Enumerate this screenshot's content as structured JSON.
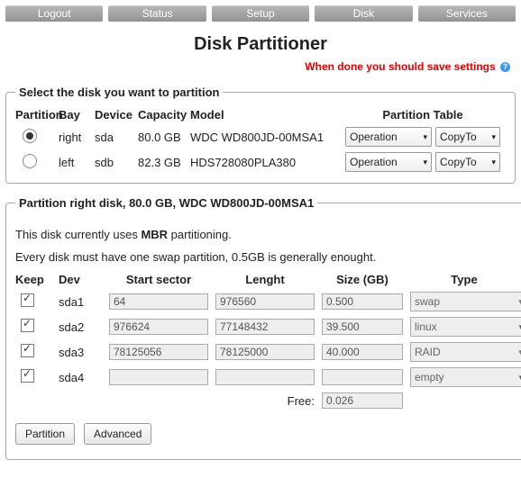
{
  "nav": [
    "Logout",
    "Status",
    "Setup",
    "Disk",
    "Services"
  ],
  "title": "Disk Partitioner",
  "warn": "When done you should save settings",
  "legend1": "Select the disk you want to partition",
  "disk_hdr": {
    "partition": "Partition",
    "bay": "Bay",
    "device": "Device",
    "capacity": "Capacity",
    "model": "Model",
    "pt": "Partition Table"
  },
  "disks": [
    {
      "selected": true,
      "bay": "right",
      "device": "sda",
      "capacity": "80.0 GB",
      "model": "WDC WD800JD-00MSA1",
      "op": "Operation",
      "copy": "CopyTo"
    },
    {
      "selected": false,
      "bay": "left",
      "device": "sdb",
      "capacity": "82.3 GB",
      "model": "HDS728080PLA380",
      "op": "Operation",
      "copy": "CopyTo"
    }
  ],
  "legend2": "Partition right disk, 80.0 GB, WDC WD800JD-00MSA1",
  "info1a": "This disk currently uses ",
  "info1b": "MBR",
  "info1c": " partitioning.",
  "info2": "Every disk must have one swap partition, 0.5GB is generally enought.",
  "part_hdr": {
    "keep": "Keep",
    "dev": "Dev",
    "start": "Start sector",
    "len": "Lenght",
    "size": "Size (GB)",
    "type": "Type"
  },
  "parts": [
    {
      "dev": "sda1",
      "start": "64",
      "len": "976560",
      "size": "0.500",
      "type": "swap"
    },
    {
      "dev": "sda2",
      "start": "976624",
      "len": "77148432",
      "size": "39.500",
      "type": "linux"
    },
    {
      "dev": "sda3",
      "start": "78125056",
      "len": "78125000",
      "size": "40.000",
      "type": "RAID"
    },
    {
      "dev": "sda4",
      "start": "",
      "len": "",
      "size": "",
      "type": "empty"
    }
  ],
  "free_lbl": "Free:",
  "free_val": "0.026",
  "btn_partition": "Partition",
  "btn_advanced": "Advanced"
}
